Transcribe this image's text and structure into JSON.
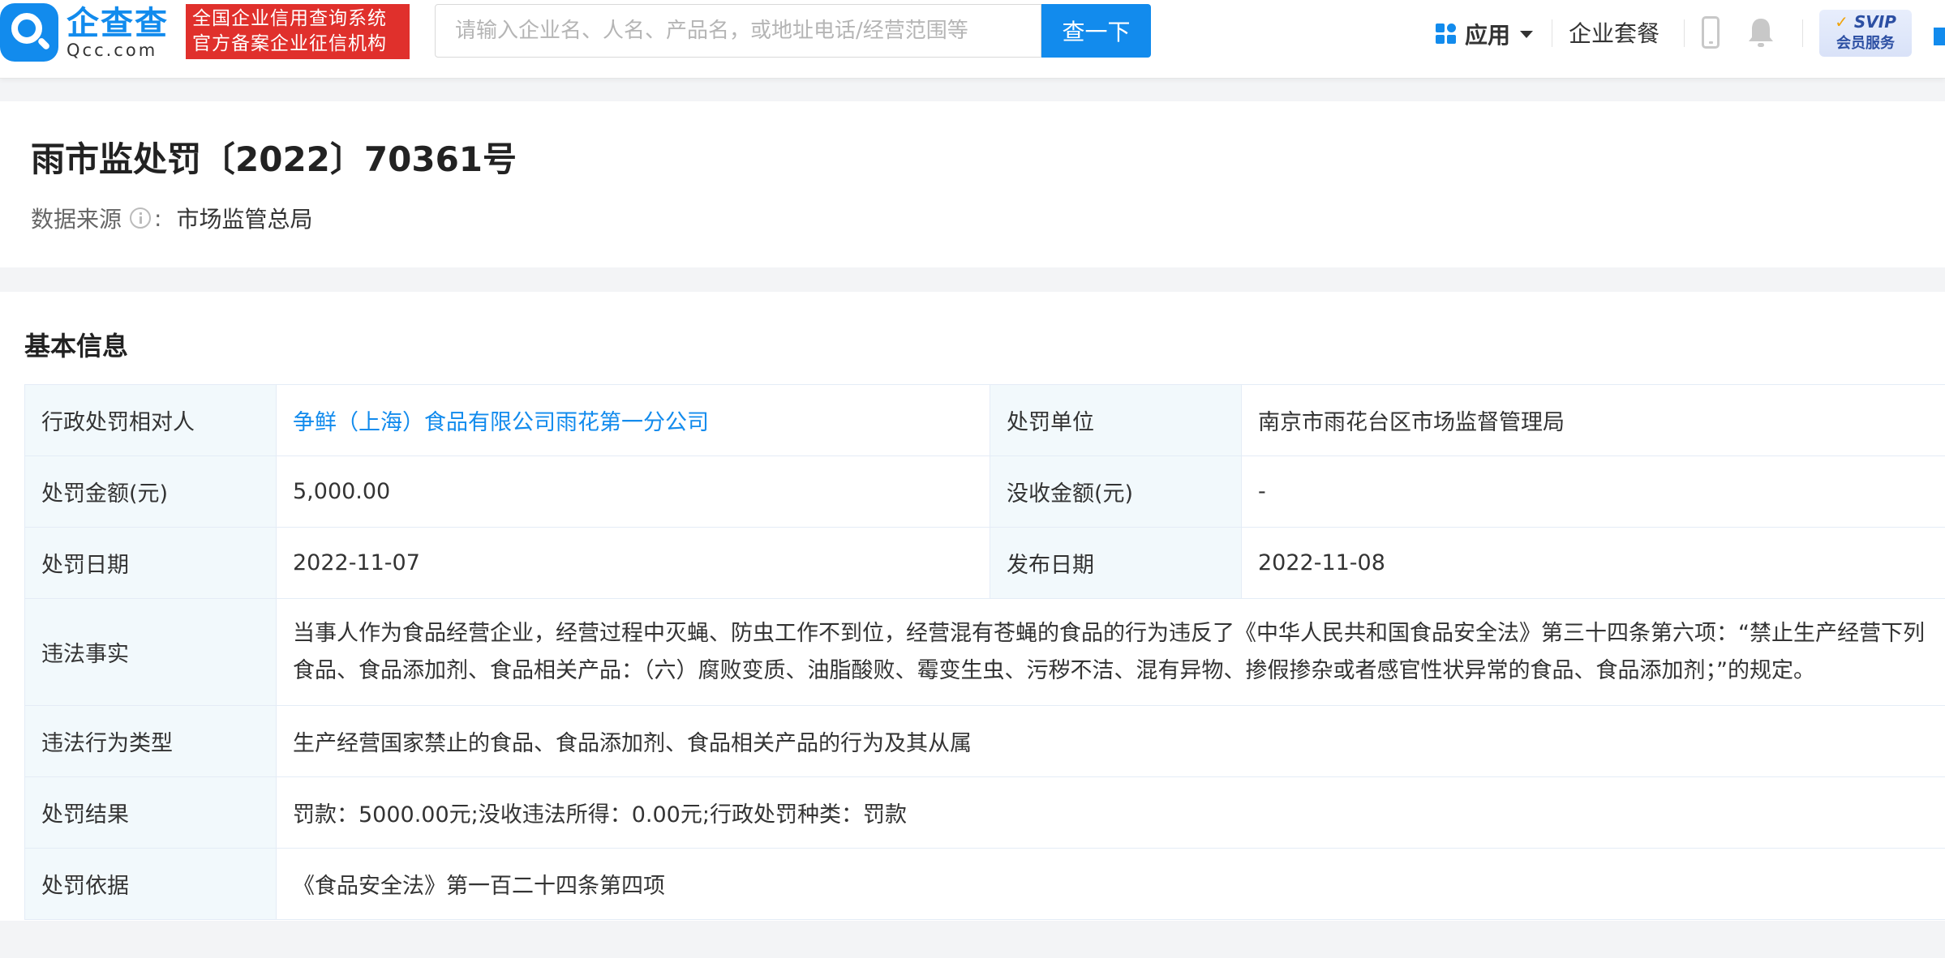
{
  "header": {
    "logo_cn": "企查查",
    "logo_en": "Qcc.com",
    "badge_line1": "全国企业信用查询系统",
    "badge_line2": "官方备案企业征信机构",
    "search_placeholder": "请输入企业名、人名、产品名，或地址电话/经营范围等",
    "search_button": "查一下",
    "apps_label": "应用",
    "plan_label": "企业套餐",
    "svip_label": "SVIP",
    "svip_sub": "会员服务",
    "accent_color": "#128bed"
  },
  "record": {
    "title": "雨市监处罚〔2022〕70361号",
    "source_label": "数据来源",
    "source_colon": ":",
    "source_value": "市场监管总局"
  },
  "basic_info": {
    "section_title": "基本信息",
    "party_label": "行政处罚相对人",
    "party_value": "争鲜（上海）食品有限公司雨花第一分公司",
    "unit_label": "处罚单位",
    "unit_value": "南京市雨花台区市场监督管理局",
    "fine_label": "处罚金额(元)",
    "fine_value": "5,000.00",
    "confiscation_label": "没收金额(元)",
    "confiscation_value": "-",
    "date_label": "处罚日期",
    "date_value": "2022-11-07",
    "publish_label": "发布日期",
    "publish_value": "2022-11-08",
    "facts_label": "违法事实",
    "facts_value": "当事人作为食品经营企业，经营过程中灭蝇、防虫工作不到位，经营混有苍蝇的食品的行为违反了《中华人民共和国食品安全法》第三十四条第六项：“禁止生产经营下列食品、食品添加剂、食品相关产品：（六）腐败变质、油脂酸败、霉变生虫、污秽不洁、混有异物、掺假掺杂或者感官性状异常的食品、食品添加剂；”的规定。",
    "type_label": "违法行为类型",
    "type_value": "生产经营国家禁止的食品、食品添加剂、食品相关产品的行为及其从属",
    "result_label": "处罚结果",
    "result_value": "罚款：5000.00元;没收违法所得：0.00元;行政处罚种类：罚款",
    "basis_label": "处罚依据",
    "basis_value": "《食品安全法》第一百二十四条第四项"
  }
}
